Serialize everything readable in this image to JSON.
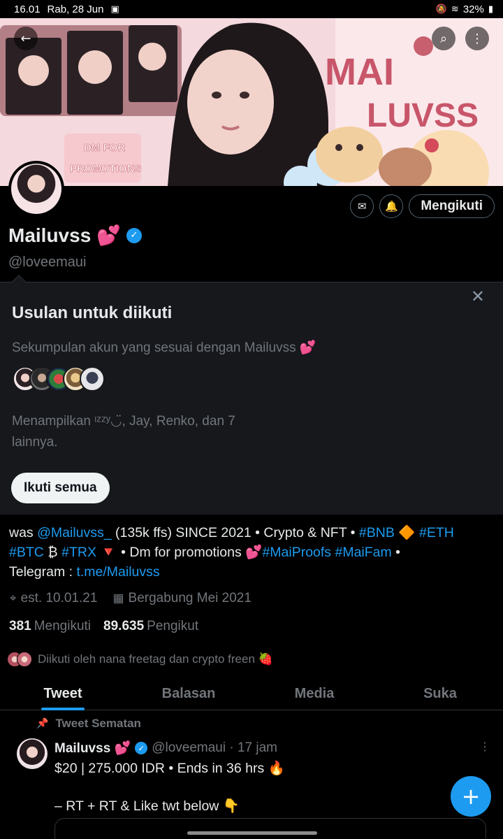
{
  "status_bar": {
    "time": "16.01",
    "date": "Rab, 28 Jun",
    "battery": "32%"
  },
  "banner": {
    "title_line1": "MAI",
    "title_line2": "LUVSS",
    "promo_line1": "DM FOR",
    "promo_line2": "PROMOTIONS"
  },
  "header": {
    "back_icon": "back-arrow-icon",
    "search_icon": "search-icon",
    "more_icon": "more-vertical-icon"
  },
  "profile": {
    "display_name": "Mailuvss 💕",
    "handle": "@loveemaui",
    "follow_button": "Mengikuti",
    "bio_part1": "was ",
    "bio_mention": "@Mailuvss_",
    "bio_part2": " (135k ffs) SINCE 2021 • Crypto & NFT • ",
    "bio_tag1": "#BNB",
    "bio_part3": " 🔶 ",
    "bio_tag2": "#ETH",
    "bio_tag3": "#BTC",
    "bio_part4": " ₿ ",
    "bio_tag4": "#TRX",
    "bio_part5": " 🔻 • Dm for promotions 💕",
    "bio_tag5": "#MaiProofs",
    "bio_tag6": "#MaiFam",
    "bio_part6": " •",
    "bio_part7": "Telegram : ",
    "bio_link": "t.me/Mailuvss",
    "location": "est. 10.01.21",
    "joined": "Bergabung Mei 2021",
    "following_count": "381",
    "following_label": "Mengikuti",
    "followers_count": "89.635",
    "followers_label": "Pengikut",
    "followed_by": "Diikuti oleh nana freetag dan crypto freen 🍓"
  },
  "suggestions": {
    "title": "Usulan untuk diikuti",
    "description": "Sekumpulan akun yang sesuai dengan Mailuvss 💕",
    "showing": "Menampilkan ᶦᶻᶻʸ◡̈, Jay, Renko, dan 7 lainnya.",
    "follow_all": "Ikuti semua"
  },
  "tabs": [
    "Tweet",
    "Balasan",
    "Media",
    "Suka"
  ],
  "pinned_tweet": {
    "label": "Tweet Sematan",
    "name": "Mailuvss 💕",
    "handle_time": "@loveemaui · 17 jam",
    "text": "$20 | 275.000 IDR • Ends in 36 hrs 🔥\n\n– RT + RT & Like twt below 👇"
  },
  "fab_label": "+",
  "colors": {
    "accent": "#1d9bf0",
    "background": "#000000",
    "muted": "#71767b",
    "card": "#16181c"
  }
}
